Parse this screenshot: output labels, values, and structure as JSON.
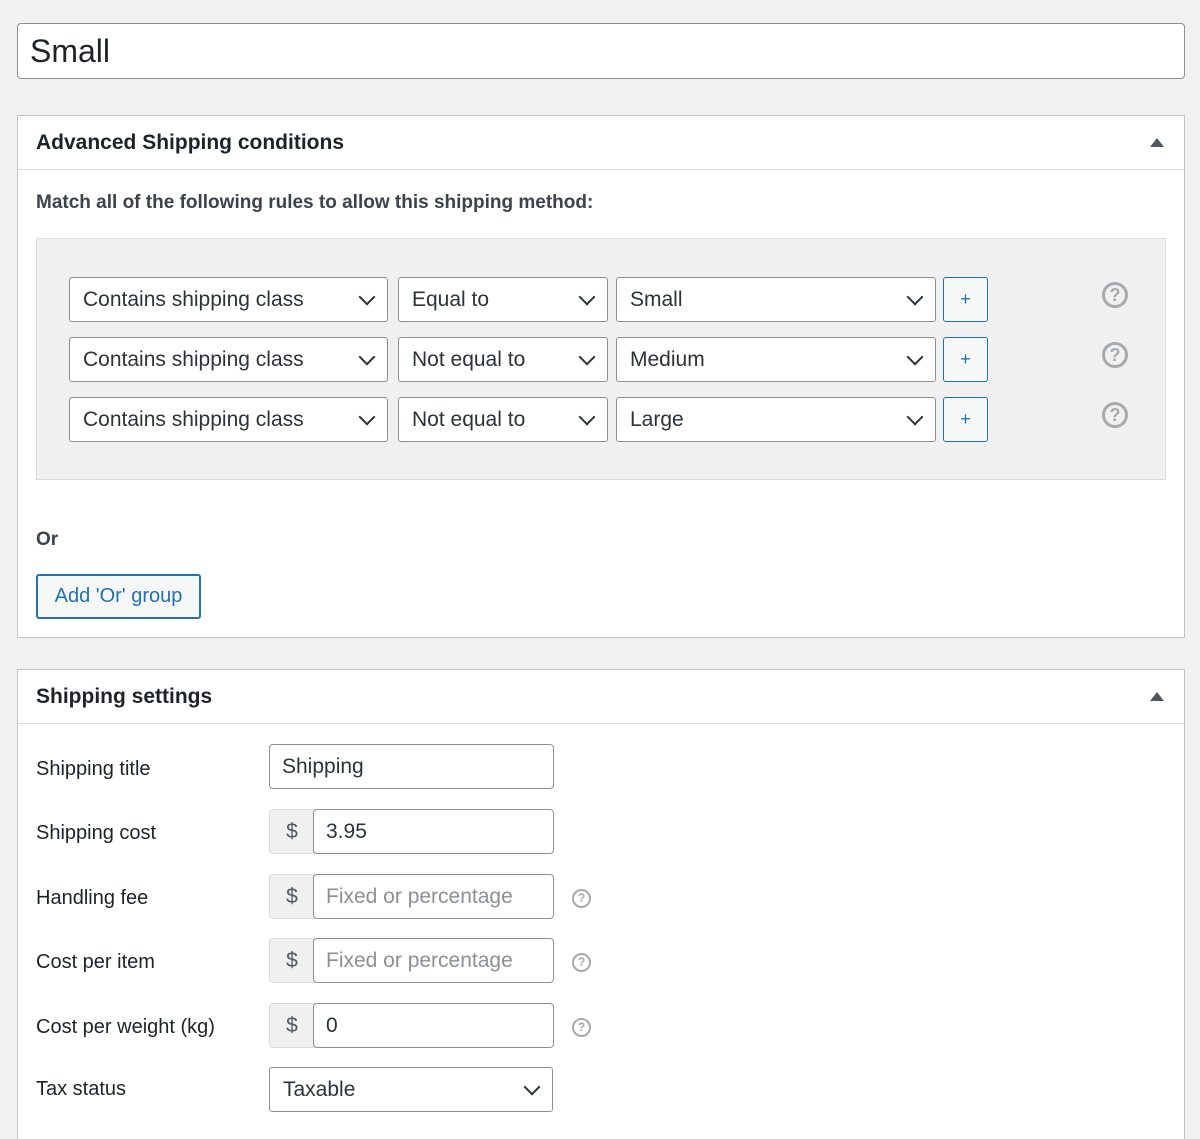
{
  "title_value": "Small",
  "conditions_box": {
    "title": "Advanced Shipping conditions",
    "intro": "Match all of the following rules to allow this shipping method:",
    "rules": [
      {
        "condition": "Contains shipping class",
        "operator": "Equal to",
        "value": "Small",
        "add_label": "+"
      },
      {
        "condition": "Contains shipping class",
        "operator": "Not equal to",
        "value": "Medium",
        "add_label": "+"
      },
      {
        "condition": "Contains shipping class",
        "operator": "Not equal to",
        "value": "Large",
        "add_label": "+"
      }
    ],
    "or_label": "Or",
    "add_or_group_label": "Add 'Or' group",
    "help_glyph": "?"
  },
  "settings_box": {
    "title": "Shipping settings",
    "shipping_title": {
      "label": "Shipping title",
      "value": "Shipping"
    },
    "shipping_cost": {
      "label": "Shipping cost",
      "prefix": "$",
      "value": "3.95"
    },
    "handling_fee": {
      "label": "Handling fee",
      "prefix": "$",
      "placeholder": "Fixed or percentage"
    },
    "cost_per_item": {
      "label": "Cost per item",
      "prefix": "$",
      "placeholder": "Fixed or percentage"
    },
    "cost_per_weight": {
      "label": "Cost per weight (kg)",
      "prefix": "$",
      "value": "0"
    },
    "tax_status": {
      "label": "Tax status",
      "value": "Taxable"
    }
  },
  "icons": {
    "toggle": "triangle-up-icon",
    "help": "question-circle-icon",
    "dropdown": "chevron-down-icon"
  },
  "colors": {
    "accent": "#2271b1",
    "page_bg": "#f1f1f1",
    "group_bg": "#f0f0f1",
    "help_icon": "#a7aaad"
  }
}
